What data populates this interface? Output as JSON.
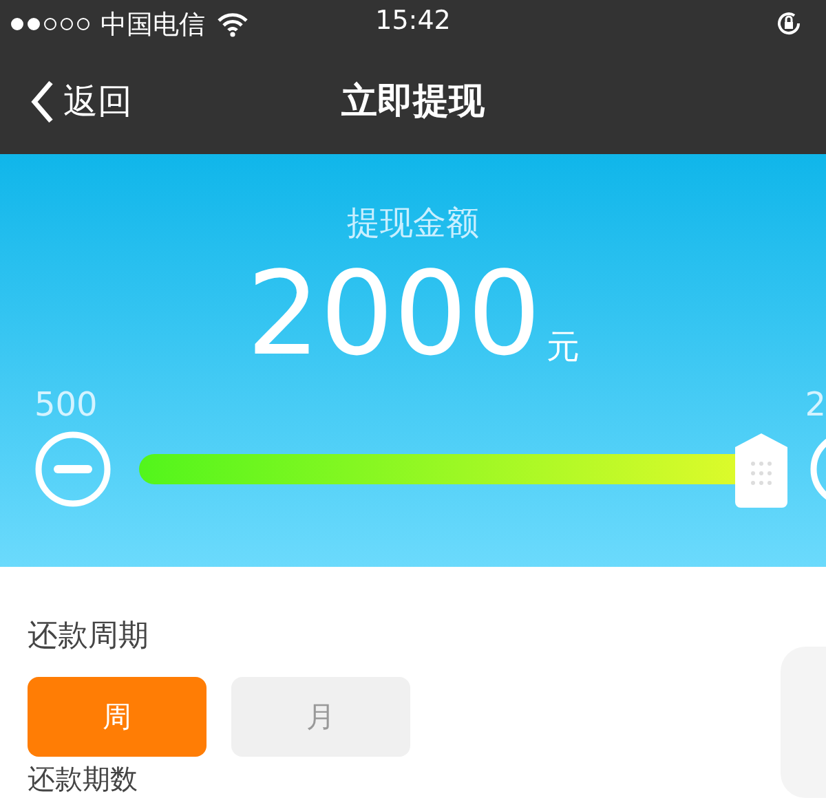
{
  "status_bar": {
    "carrier": "中国电信",
    "time": "15:42"
  },
  "nav_bar": {
    "back_label": "返回",
    "title": "立即提现"
  },
  "amount_panel": {
    "label": "提现金额",
    "amount": "2000",
    "unit": "元",
    "min_label": "500",
    "max_label": "2",
    "slider": {
      "level": 1
    }
  },
  "repayment_cycle": {
    "label": "还款周期",
    "options": [
      {
        "label": "周",
        "selected": true
      },
      {
        "label": "月",
        "selected": false
      }
    ]
  },
  "next_section": {
    "label": "还款期数"
  }
}
